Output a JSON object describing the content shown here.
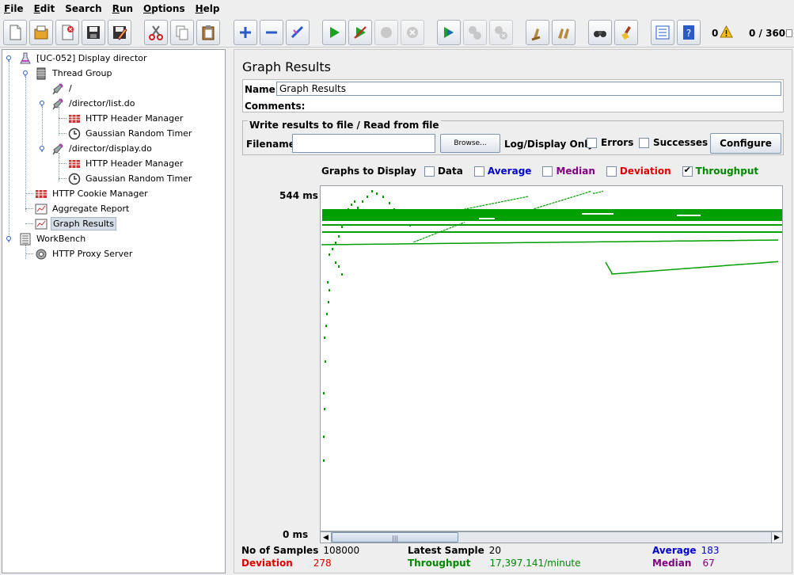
{
  "menu": [
    {
      "mnemonic": "F",
      "rest": "ile"
    },
    {
      "mnemonic": "E",
      "rest": "dit"
    },
    {
      "mnemonic": "",
      "rest": "Search"
    },
    {
      "mnemonic": "R",
      "rest": "un"
    },
    {
      "mnemonic": "O",
      "rest": "ptions"
    },
    {
      "mnemonic": "H",
      "rest": "elp"
    }
  ],
  "toolbar": {
    "error_count": "0",
    "thread_status": "0 / 360",
    "buttons": [
      "new-icon",
      "open-icon",
      "close-icon",
      "save-icon",
      "save-as-icon",
      "cut-icon",
      "copy-icon",
      "paste-icon",
      "expand-icon",
      "collapse-icon",
      "toggle-icon",
      "start-icon",
      "start-no-timers-icon",
      "stop-icon",
      "shutdown-icon",
      "remote-start-icon",
      "remote-stop-icon",
      "remote-shutdown-icon",
      "clear-icon",
      "clear-all-icon",
      "search-icon",
      "reset-search-icon",
      "function-helper-icon",
      "help-icon"
    ]
  },
  "tree": {
    "items": [
      {
        "label": "[UC-052] Display director",
        "icon": "test-plan-icon"
      },
      {
        "label": "Thread Group",
        "icon": "thread-group-icon"
      },
      {
        "label": "/",
        "icon": "sampler-icon"
      },
      {
        "label": "/director/list.do",
        "icon": "sampler-icon"
      },
      {
        "label": "HTTP Header Manager",
        "icon": "header-manager-icon"
      },
      {
        "label": "Gaussian Random Timer",
        "icon": "timer-icon"
      },
      {
        "label": "/director/display.do",
        "icon": "sampler-icon"
      },
      {
        "label": "HTTP Header Manager",
        "icon": "header-manager-icon"
      },
      {
        "label": "Gaussian Random Timer",
        "icon": "timer-icon"
      },
      {
        "label": "HTTP Cookie Manager",
        "icon": "cookie-manager-icon"
      },
      {
        "label": "Aggregate Report",
        "icon": "report-icon"
      },
      {
        "label": "Graph Results",
        "icon": "report-icon"
      },
      {
        "label": "WorkBench",
        "icon": "workbench-icon"
      },
      {
        "label": "HTTP Proxy Server",
        "icon": "proxy-icon"
      }
    ],
    "selected_index": 11
  },
  "panel": {
    "title": "Graph Results",
    "name_label": "Name:",
    "name_value": "Graph Results",
    "comments_label": "Comments:",
    "file_section_title": "Write results to file / Read from file",
    "filename_label": "Filename",
    "filename_value": "",
    "browse_label": "Browse...",
    "log_display_label": "Log/Display Only:",
    "errors_label": "Errors",
    "errors_checked": false,
    "successes_label": "Successes",
    "successes_checked": false,
    "configure_label": "Configure"
  },
  "graph_options": {
    "label": "Graphs to Display",
    "options": [
      {
        "label": "Data",
        "checked": false,
        "color": "#000000"
      },
      {
        "label": "Average",
        "checked": false,
        "color": "#0000cc"
      },
      {
        "label": "Median",
        "checked": false,
        "color": "#800080"
      },
      {
        "label": "Deviation",
        "checked": false,
        "color": "#dd0000"
      },
      {
        "label": "Throughput",
        "checked": true,
        "color": "#008800"
      }
    ]
  },
  "chart_data": {
    "type": "line",
    "y_top_label": "544  ms",
    "y_bottom_label": "0  ms",
    "ylim": [
      0,
      544
    ],
    "series_color": "#00a000"
  },
  "stats": {
    "samples_label": "No of Samples",
    "samples_value": "108000",
    "latest_label": "Latest Sample",
    "latest_value": "20",
    "average_label": "Average",
    "average_value": "183",
    "deviation_label": "Deviation",
    "deviation_value": "278",
    "throughput_label": "Throughput",
    "throughput_value": "17,397.141/minute",
    "median_label": "Median",
    "median_value": "67",
    "colors": {
      "deviation": "#dd0000",
      "throughput": "#008800",
      "average": "#0000cc",
      "median": "#800080"
    }
  }
}
